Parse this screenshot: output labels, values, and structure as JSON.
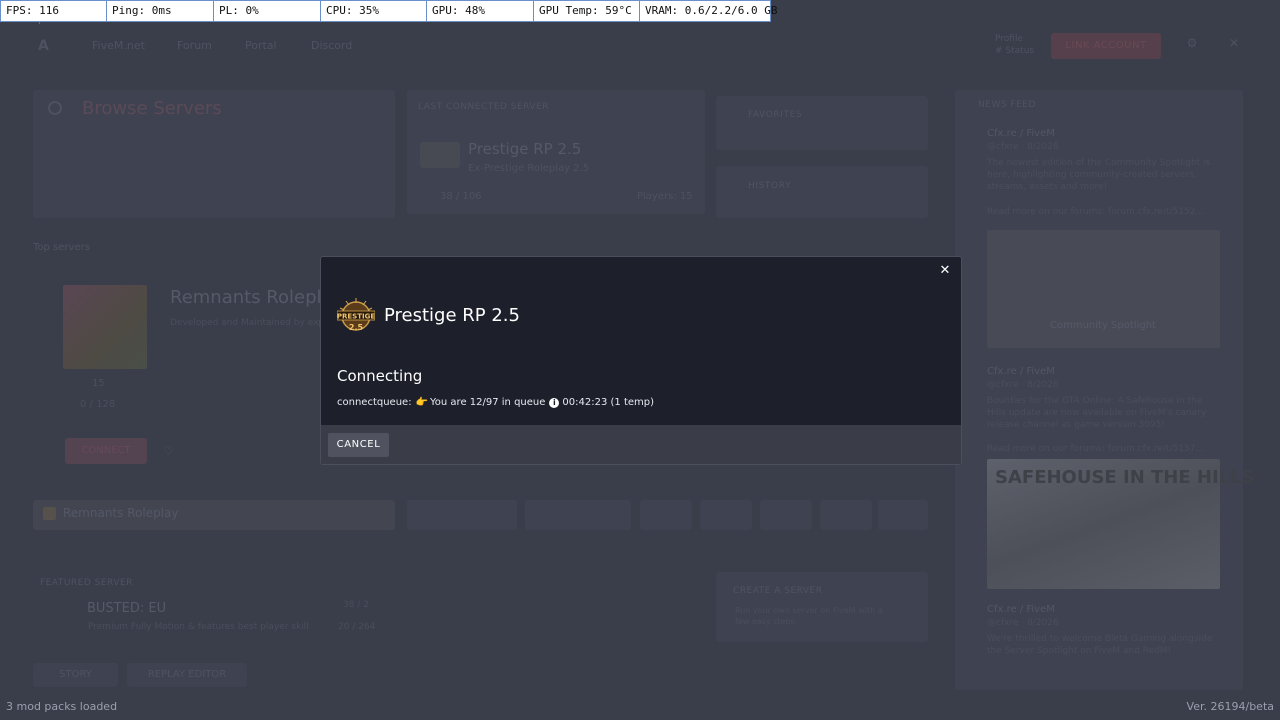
{
  "perf": {
    "fps": "FPS: 116",
    "ping": "Ping: 0ms",
    "pl": "PL: 0%",
    "cpu": "CPU: 35%",
    "gpu": "GPU: 48%",
    "gpu_temp": "GPU Temp: 59°C",
    "vram": "VRAM: 0.6/2.2/6.0 GB",
    "fps_ghost": "116fps"
  },
  "background": {
    "nav": {
      "logo": "A",
      "links": [
        "FiveM.net",
        "Forum",
        "Portal",
        "Discord"
      ],
      "side_top": "Profile",
      "side_bottom": "# Status",
      "link_account": "LINK ACCOUNT",
      "settings_icon": "⚙",
      "exit_icon": "✕"
    },
    "browse_title": "Browse Servers",
    "last_connected_label": "LAST CONNECTED SERVER",
    "last_server": {
      "name": "Prestige RP 2.5",
      "sub": "Ex-Prestige Roleplay 2.5",
      "stats": "38 / 106",
      "count": "Players: 15"
    },
    "favorites_label": "FAVORITES",
    "history_label": "HISTORY",
    "top_servers_label": "Top servers",
    "featured": {
      "name": "Remnants Roleplay",
      "sub": "Developed and Maintained by experienced devs",
      "likes": "15",
      "players": "0 / 128",
      "connect": "CONNECT"
    },
    "rem_bar_label": "Remnants Roleplay",
    "featured_label": "FEATURED SERVER",
    "busted": {
      "name": "BUSTED: EU",
      "sub": "Premium Fully Motion & features best player skill",
      "count": "38 / 2",
      "players": "20 / 264"
    },
    "create_label": "CREATE A SERVER",
    "create_text": "Run your own server on FiveM with a few easy steps.",
    "story_label": "STORY",
    "replay_label": "REPLAY EDITOR",
    "feed": {
      "title": "NEWS FEED",
      "post1_author": "Cfx.re / FiveM",
      "post1_handle": "@cfxre · 8/2026",
      "post1_text": "The newest edition of the Community Spotlight is here, highlighting community-created servers, streams, assets and more!",
      "post1_link": "Read more on our forums: forum.cfx.re/t/5152...",
      "post1_caption": "Community Spotlight",
      "post2_author": "Cfx.re / FiveM",
      "post2_handle": "@cfxre · 8/2026",
      "post2_text": "Bounties for the GTA Online: A Safehouse in the Hills update are now available on FiveM's canary release channel as game version 3095!",
      "post2_link": "Read more on our forums: forum.cfx.re/t/5157...",
      "post2_img_title": "SAFEHOUSE IN THE HILLS",
      "post3_author": "Cfx.re / FiveM",
      "post3_handle": "@cfxre · 8/2026",
      "post3_text": "We're thrilled to welcome Bleta Gaming alongside the Server Spotlight on FiveM and RedM!"
    }
  },
  "footer": {
    "mods": "3 mod packs loaded",
    "version": "Ver. 26194/beta"
  },
  "modal": {
    "close_icon": "✕",
    "server_name": "Prestige RP 2.5",
    "logo_text": "PRESTIGE",
    "logo_version": "2.5",
    "status_title": "Connecting",
    "queue_prefix": "connectqueue:",
    "queue_emoji": "👉",
    "queue_text": "You are 12/97 in queue",
    "info_icon": "i",
    "queue_time": "00:42:23 (1 temp)",
    "cancel_label": "CANCEL"
  }
}
